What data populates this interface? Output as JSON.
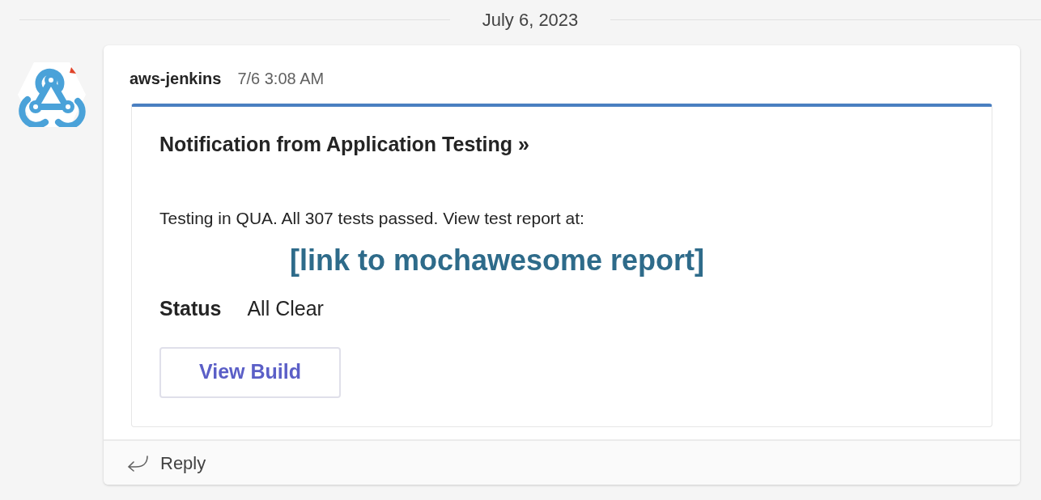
{
  "date_divider": "July 6, 2023",
  "message": {
    "sender": "aws-jenkins",
    "time": "7/6 3:08 AM",
    "card": {
      "title": "Notification from Application Testing »",
      "body": "Testing in QUA. All 307 tests passed. View test report at:",
      "link": "[link to mochawesome report]",
      "facts": [
        {
          "label": "Status",
          "value": "All Clear"
        }
      ],
      "buttons": [
        "View Build"
      ]
    },
    "reply": "Reply"
  }
}
